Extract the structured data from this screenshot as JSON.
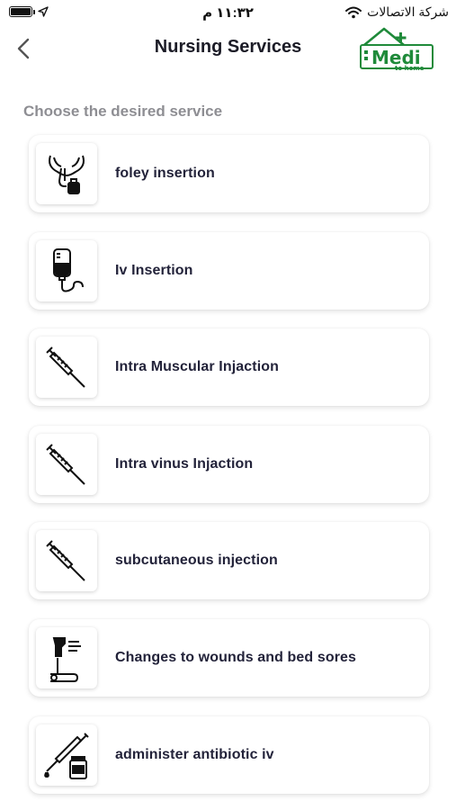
{
  "status_bar": {
    "time": "١١:٣٢ م",
    "carrier": "شركة الاتصالات",
    "icons": [
      "battery-icon",
      "location-arrow-icon",
      "wifi-icon"
    ]
  },
  "header": {
    "title": "Nursing Services",
    "back_icon": "chevron-left-icon",
    "logo": {
      "brand": "Medi",
      "tagline": "to home",
      "color": "#1f8a3a"
    }
  },
  "section": {
    "label": "Choose the desired service"
  },
  "services": [
    {
      "label": "foley insertion",
      "icon": "foley-catheter-icon"
    },
    {
      "label": "Iv Insertion",
      "icon": "iv-bag-icon"
    },
    {
      "label": "Intra Muscular Injaction",
      "icon": "syringe-icon"
    },
    {
      "label": "Intra vinus Injaction",
      "icon": "syringe-icon"
    },
    {
      "label": "subcutaneous injection",
      "icon": "syringe-icon"
    },
    {
      "label": "Changes to wounds and bed sores",
      "icon": "wound-bandage-icon"
    },
    {
      "label": "administer antibiotic iv",
      "icon": "antibiotic-vial-icon"
    }
  ]
}
